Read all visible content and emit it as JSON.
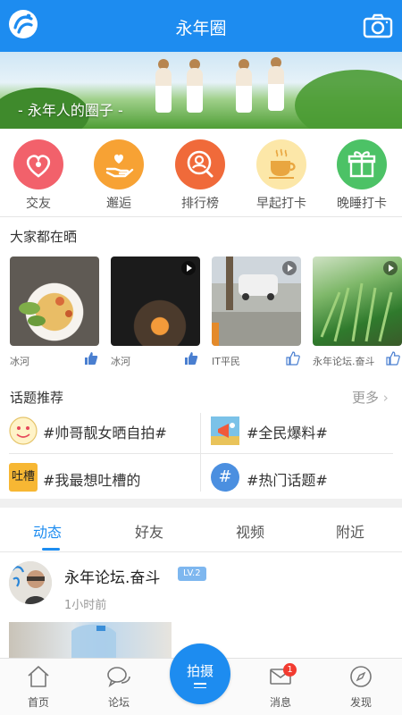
{
  "header": {
    "title": "永年圈",
    "logo_icon": "yongnian-logo-icon",
    "camera_icon": "camera-icon",
    "color": "#1d8cf0"
  },
  "banner": {
    "caption": "- 永年人的圈子 -"
  },
  "categories": [
    {
      "label": "交友",
      "icon": "heart-icon",
      "color": "#f2616b"
    },
    {
      "label": "邂逅",
      "icon": "hand-heart-icon",
      "color": "#f7a234"
    },
    {
      "label": "排行榜",
      "icon": "search-person-icon",
      "color": "#f06a3a"
    },
    {
      "label": "早起打卡",
      "icon": "coffee-cup-icon",
      "color": "#fce7a8"
    },
    {
      "label": "晚睡打卡",
      "icon": "gift-icon",
      "color": "#4cc266"
    }
  ],
  "showcase": {
    "title": "大家都在晒",
    "items": [
      {
        "user": "冰河",
        "media": "photo"
      },
      {
        "user": "冰河",
        "media": "video"
      },
      {
        "user": "IT平民",
        "media": "video"
      },
      {
        "user": "永年论坛.奋斗",
        "media": "video"
      }
    ]
  },
  "topics": {
    "title": "话题推荐",
    "more": "更多",
    "items": [
      {
        "label": "#帅哥靓女晒自拍#",
        "icon": "selfie-sticker-icon"
      },
      {
        "label": "#全民爆料#",
        "icon": "megaphone-icon"
      },
      {
        "label": "#我最想吐槽的",
        "icon": "tucao-sticker-icon",
        "icon_text": "吐槽"
      },
      {
        "label": "#热门话题#",
        "icon": "hashtag-icon",
        "icon_text": "#"
      }
    ]
  },
  "tabs": [
    {
      "label": "动态",
      "active": true
    },
    {
      "label": "好友",
      "active": false
    },
    {
      "label": "视频",
      "active": false
    },
    {
      "label": "附近",
      "active": false
    }
  ],
  "post": {
    "name": "永年论坛.奋斗",
    "level": "LV.2",
    "time": "1小时前"
  },
  "nav": {
    "items": [
      {
        "label": "首页",
        "icon": "home-icon"
      },
      {
        "label": "论坛",
        "icon": "chat-bubbles-icon"
      },
      {
        "label": "消息",
        "icon": "mail-icon"
      },
      {
        "label": "发现",
        "icon": "compass-icon"
      }
    ],
    "shoot_label": "拍摄",
    "message_badge": "1"
  }
}
